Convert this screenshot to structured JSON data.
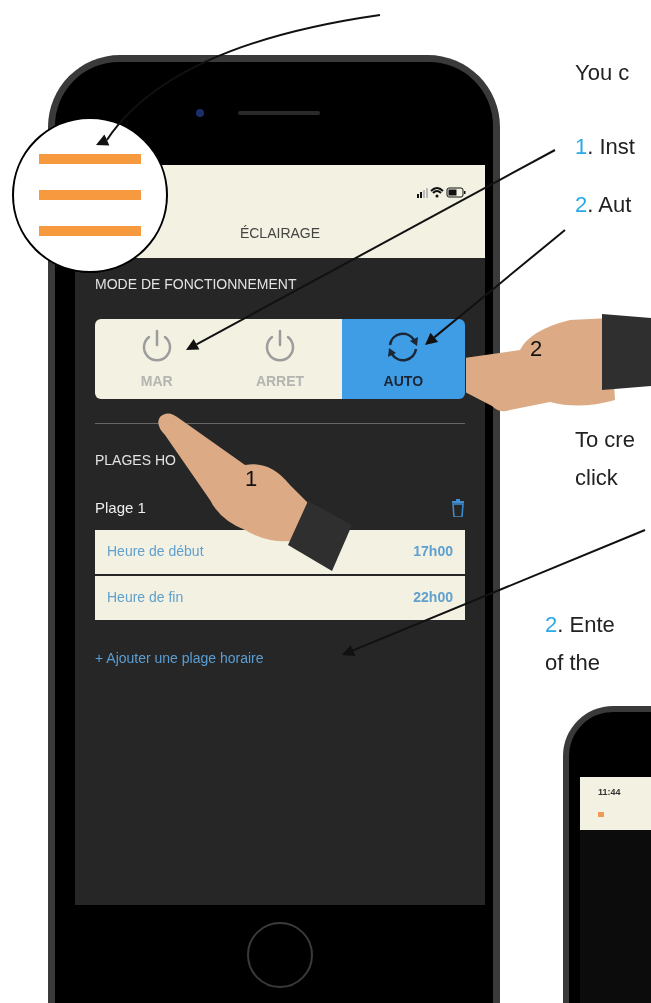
{
  "intro": "You c",
  "steps": [
    {
      "number": "1",
      "text": ". Inst"
    },
    {
      "number": "2",
      "text": ". Aut"
    }
  ],
  "note_lines": [
    "To cre",
    "click"
  ],
  "step_bottom": {
    "number": "2",
    "text": ". Ente",
    "continuation": "of the"
  },
  "hands": [
    {
      "label": "1"
    },
    {
      "label": "2"
    }
  ],
  "phone": {
    "title": "ÉCLAIRAGE",
    "mode_section": "MODE DE FONCTIONNEMENT",
    "modes": [
      {
        "kind": "power",
        "label": "MAR",
        "selected": false
      },
      {
        "kind": "power",
        "label": "ARRET",
        "selected": false
      },
      {
        "kind": "cycle",
        "label": "AUTO",
        "selected": true
      }
    ],
    "schedule_section": "PLAGES HO",
    "slot_title": "Plage 1",
    "slot_rows": [
      {
        "label": "Heure de début",
        "value": "17h00"
      },
      {
        "label": "Heure de fin",
        "value": "22h00"
      }
    ],
    "add_link": "+ Ajouter une plage horaire"
  },
  "second_phone": {
    "time": "11:44"
  }
}
